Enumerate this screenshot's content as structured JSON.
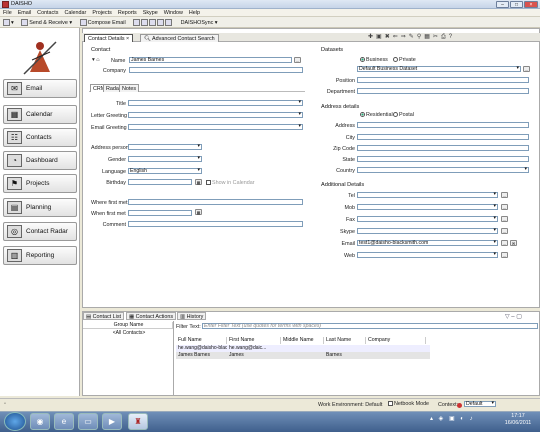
{
  "window": {
    "title": "DAISHO"
  },
  "menu": [
    "File",
    "Email",
    "Contacts",
    "Calendar",
    "Projects",
    "Reports",
    "Skype",
    "Window",
    "Help"
  ],
  "toolbar": {
    "send_receive": "Send & Receive",
    "compose": "Compose Email",
    "sync": "DAISHOSync"
  },
  "nav": [
    "Email",
    "Calendar",
    "Contacts",
    "Dashboard",
    "Projects",
    "Planning",
    "Contact Radar",
    "Reporting"
  ],
  "tabs": {
    "contact_details": "Contact Details",
    "advanced_search": "Advanced Contact Search"
  },
  "contact": {
    "header": "Contact",
    "name_label": "Name",
    "name_value": "James Barnes",
    "company_label": "Company",
    "subtabs": [
      "CRM",
      "Radar",
      "Notes"
    ],
    "title_label": "Title",
    "letter_greeting_label": "Letter Greeting",
    "email_greeting_label": "Email Greeting",
    "address_person_label": "Address person",
    "gender_label": "Gender",
    "language_label": "Language",
    "language_value": "English",
    "birthday_label": "Birthday",
    "show_in_calendar": "Show in Calendar",
    "where_first_met": "Where first met",
    "when_first_met": "When first met",
    "comment": "Comment"
  },
  "datasets": {
    "header": "Datasets",
    "business": "Business",
    "private": "Private",
    "dataset_value": "Default Business Dataset",
    "position_label": "Position",
    "department_label": "Department"
  },
  "address": {
    "header": "Address details",
    "residential": "Residential",
    "postal": "Postal",
    "address_label": "Address",
    "city_label": "City",
    "zip_label": "Zip Code",
    "state_label": "State",
    "country_label": "Country"
  },
  "additional": {
    "header": "Additional Details",
    "tel": "Tel",
    "mob": "Mob",
    "fax": "Fax",
    "skype": "Skype",
    "email": "Email",
    "email_value": "test1@daisho-blacksmith.com",
    "web": "Web"
  },
  "bottom": {
    "tabs": [
      "Contact List",
      "Contact Actions",
      "History"
    ],
    "group_header": "Group Name",
    "group_all": "<All Contacts>",
    "filter_label": "Filter Text:",
    "filter_placeholder": "Enter Filter Text (use quotes for terms with spaces)",
    "columns": [
      "Full Name",
      "First Name",
      "Middle Name",
      "Last Name",
      "Company"
    ],
    "rows": [
      [
        "he.wang@daisho-blacks...",
        "he.wang@daic...",
        "",
        "",
        ""
      ],
      [
        "James Barnes",
        "James",
        "",
        "Barnes",
        ""
      ]
    ]
  },
  "status": {
    "work_env": "Work Environment: Default",
    "netbook": "Netbook Mode",
    "context_label": "Context:",
    "context_value": "Default"
  },
  "clock": {
    "time": "17:17",
    "date": "16/06/2011"
  }
}
